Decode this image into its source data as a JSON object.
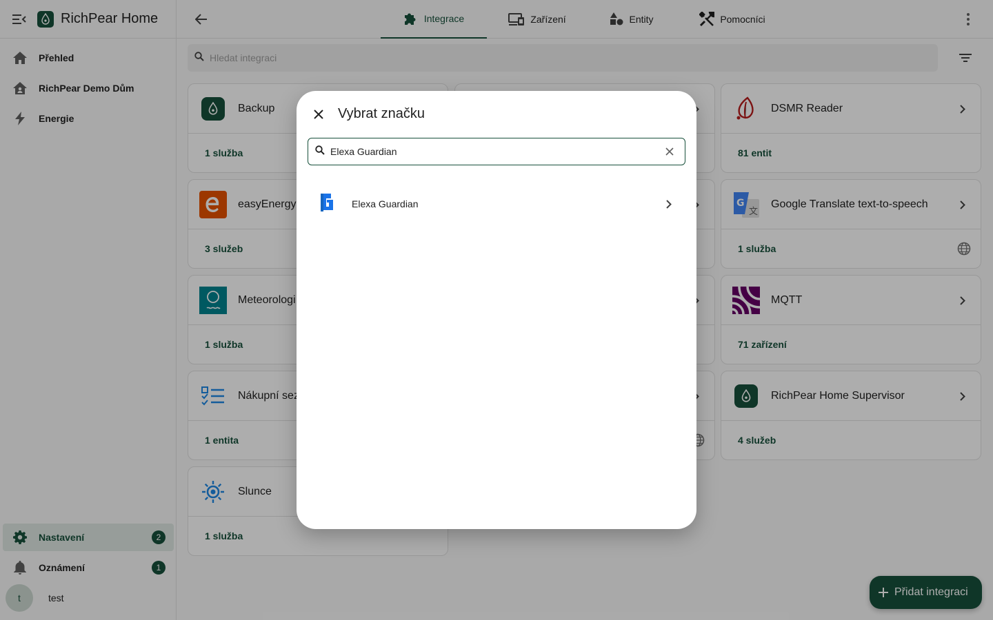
{
  "app": {
    "title": "RichPear Home"
  },
  "sidebar": {
    "items": [
      {
        "label": "Přehled",
        "icon": "home-icon"
      },
      {
        "label": "RichPear Demo Dům",
        "icon": "home-account-icon"
      },
      {
        "label": "Energie",
        "icon": "lightning-icon"
      }
    ],
    "settings": {
      "label": "Nastavení",
      "badge": "2"
    },
    "notifications": {
      "label": "Oznámení",
      "badge": "1"
    },
    "user": {
      "initial": "t",
      "name": "test"
    }
  },
  "tabs": [
    {
      "label": "Integrace",
      "icon": "puzzle-icon",
      "active": true
    },
    {
      "label": "Zařízení",
      "icon": "devices-icon"
    },
    {
      "label": "Entity",
      "icon": "shapes-icon"
    },
    {
      "label": "Pomocníci",
      "icon": "tools-icon"
    }
  ],
  "search": {
    "placeholder": "Hledat integraci"
  },
  "cards": [
    {
      "title": "Backup",
      "link": "1 služba"
    },
    {
      "title": "DSMR Reader",
      "link": "81 entit"
    },
    {
      "title": "easyEnergy",
      "link": "3 služeb"
    },
    {
      "title": "Google Translate text-to-speech",
      "link": "1 služba"
    },
    {
      "title": "Meteorologi",
      "link": "1 služba"
    },
    {
      "title": "MQTT",
      "link": "71 zařízení"
    },
    {
      "title": "Nákupní sez",
      "link": "1 entita"
    },
    {
      "title": "RichPear Home Supervisor",
      "link": "4 služeb"
    },
    {
      "title": "Slunce",
      "link": "1 služba"
    }
  ],
  "dialog": {
    "title": "Vybrat značku",
    "search_value": "Elexa Guardian",
    "results": [
      {
        "label": "Elexa Guardian",
        "icon": "elexa-guardian-logo-icon"
      }
    ]
  },
  "fab": {
    "label": "Přidat integraci"
  },
  "colors": {
    "primary": "#17503b",
    "active_bg": "#dfe7e3"
  }
}
